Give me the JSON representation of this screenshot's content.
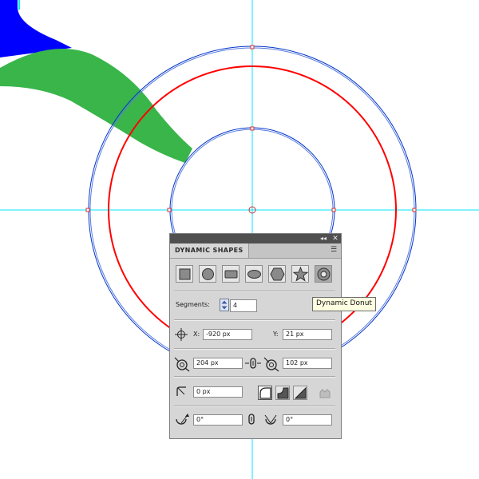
{
  "panel": {
    "title": "DYNAMIC SHAPES",
    "collapse_icon": "double-chevron-icon",
    "close_icon": "close-icon",
    "menu_icon": "panel-menu-icon",
    "shapes": [
      {
        "name": "rectangle",
        "icon": "square-icon"
      },
      {
        "name": "ellipse",
        "icon": "circle-icon"
      },
      {
        "name": "rounded-rectangle",
        "icon": "rounded-rect-icon"
      },
      {
        "name": "oval",
        "icon": "oval-icon"
      },
      {
        "name": "polygon",
        "icon": "hexagon-icon"
      },
      {
        "name": "star",
        "icon": "star-icon"
      },
      {
        "name": "donut",
        "icon": "donut-icon",
        "selected": true
      }
    ],
    "segments_label": "Segments:",
    "segments_value": "4",
    "x_label": "X:",
    "x_value": "-920 px",
    "y_label": "Y:",
    "y_value": "21 px",
    "outer_radius_value": "204 px",
    "inner_radius_value": "102 px",
    "corner_radius_value": "0 px",
    "start_angle_value": "0°",
    "end_angle_value": "0°"
  },
  "tooltip": {
    "text": "Dynamic Donut"
  },
  "colors": {
    "guide": "#00e5ff",
    "outline": "#0033cc",
    "red_ring": "#ff0000",
    "green_shape": "#39b54a",
    "blue_shape": "#0000ff",
    "panel_bg": "#d6d6d6",
    "title_bar": "#505050"
  }
}
